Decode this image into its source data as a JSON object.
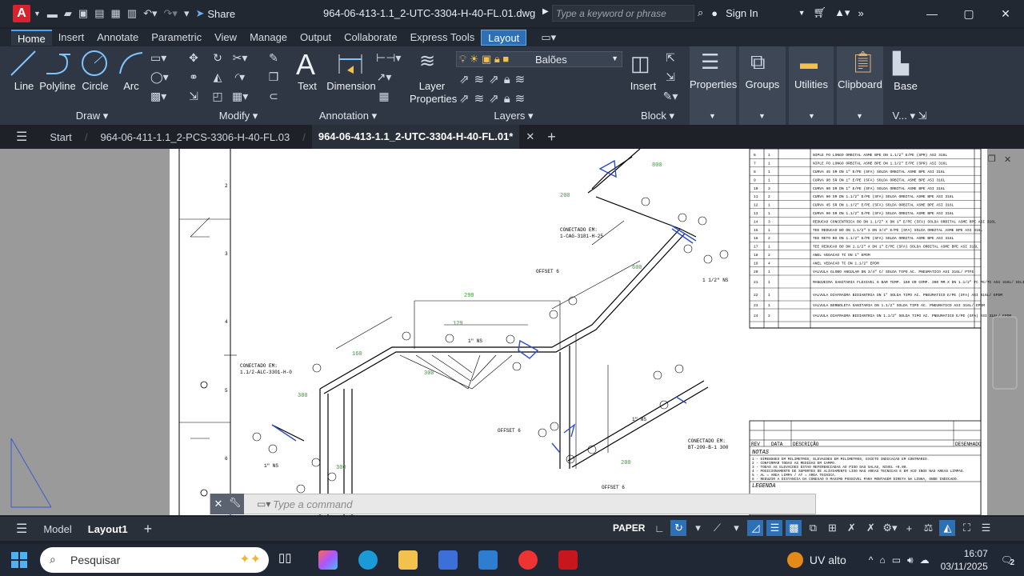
{
  "app": {
    "logo_letter": "A",
    "share_label": "Share",
    "title": "964-06-413-1.1_2-UTC-3304-H-40-FL.01.dwg",
    "search_placeholder": "Type a keyword or phrase",
    "sign_in": "Sign In"
  },
  "ribbon_tabs": [
    "Home",
    "Insert",
    "Annotate",
    "Parametric",
    "View",
    "Manage",
    "Output",
    "Collaborate",
    "Express Tools",
    "Layout"
  ],
  "draw": {
    "line": "Line",
    "polyline": "Polyline",
    "circle": "Circle",
    "arc": "Arc",
    "group": "Draw"
  },
  "modify": {
    "group": "Modify"
  },
  "annotation": {
    "text": "Text",
    "dimension": "Dimension",
    "group": "Annotation"
  },
  "layers": {
    "layer_properties": "Layer Properties",
    "current_layer": "Balões",
    "group": "Layers"
  },
  "block": {
    "insert": "Insert",
    "group": "Block"
  },
  "panels": {
    "properties": "Properties",
    "groups": "Groups",
    "utilities": "Utilities",
    "clipboard": "Clipboard",
    "base": "Base",
    "view_short": "V..."
  },
  "doc_tabs": {
    "start": "Start",
    "tab1": "964-06-411-1.1_2-PCS-3306-H-40-FL.03",
    "tab2": "964-06-413-1.1_2-UTC-3304-H-40-FL.01*"
  },
  "command": {
    "placeholder": "Type a command"
  },
  "status": {
    "model": "Model",
    "layout1": "Layout1",
    "paper": "PAPER"
  },
  "taskbar": {
    "search": "Pesquisar",
    "weather": "UV alto",
    "time": "16:07",
    "date": "03/11/2025",
    "badge": "2"
  },
  "drawing": {
    "row_numbers": [
      "2",
      "3",
      "4",
      "5",
      "6"
    ],
    "labels": {
      "connected1": "CONECTADO EM:",
      "connected1b": "1-CAG-3181-H-25",
      "connected2": "CONECTADO EM:",
      "connected2b": "1.1/2-ALC-3301-H-0",
      "connected3": "CONECTADO EM:",
      "connected3b": "BT-209-B-1 300",
      "offset1": "OFFSET 6",
      "offset2": "OFFSET 6",
      "offset3": "OFFSET 6",
      "ns1": "1\" NS",
      "ns2": "1 1/2\" NS",
      "ns3": "1\" NS",
      "ns4": "1\" NS",
      "dim1": "298",
      "dim2": "129"
    },
    "bom_rows": [
      [
        "6",
        "1",
        "NIPLE FO LONGO ORBITAL ASME BPE DN 1.1/2\" E/PE (SPR) ASI 316L"
      ],
      [
        "7",
        "1",
        "NIPLE FO LONGO ORBITAL ASME BPE DN 1.1/2\" E/PE (SPR) ASI 316L"
      ],
      [
        "8",
        "1",
        "CURVA 45 SR DN 1\" E/PE (SFA) SOLDA ORBITAL ASME BPE ASI 316L"
      ],
      [
        "9",
        "1",
        "CURVA 90 SR DN 1\" E/PE (SFA) SOLDA ORBITAL ASME BPE ASI 316L"
      ],
      [
        "10",
        "3",
        "CURVA 90 SR DN 1\" E/PE (SFA) SOLDA ORBITAL ASME BPE ASI 316L"
      ],
      [
        "11",
        "2",
        "CURVA 90 SR DN 1.1/2\" E/PE (SFA) SOLDA ORBITAL ASME BPE ASI 316L"
      ],
      [
        "12",
        "1",
        "CURVA 45 SR DN 1.1/2\" E/PE (SFA) SOLDA ORBITAL ASME BPE ASI 316L"
      ],
      [
        "13",
        "1",
        "CURVA 90 SR DN 1.1/2\" E/PE (SFA) SOLDA ORBITAL ASME BPE ASI 316L"
      ],
      [
        "14",
        "3",
        "REDUCAO CONCENTRICA BO DN 1.1/2\" X DN 1\" E/PE (SFA) SOLDA ORBITAL ASME BPE ASI 316L"
      ],
      [
        "15",
        "1",
        "TEE REDUCAO BO DN 1.1/2\" X DN 3/4\" E/PE (SFA) SOLDA ORBITAL ASME BPE ASI 316L"
      ],
      [
        "16",
        "2",
        "TEE RETO BO DN 1.1/2\" E/PE (SFA) SOLDA ORBITAL ASME BPE ASI 316L"
      ],
      [
        "17",
        "1",
        "TEE REDUCAO BO DN 1.1/2\" X DN 1\" E/PE (SFA) SOLDA ORBITAL ASME BPE ASI 316L"
      ],
      [
        "18",
        "2",
        "ANEL VEDACAO TC DN 1\" EPDM"
      ],
      [
        "19",
        "4",
        "ANEL VEDACAO TC DN 1.1/2\" EPDM"
      ],
      [
        "20",
        "1",
        "VALVULA GLOBO ANGULAR DN 3/4\" C/ SOLDA TIPO AC. PNEUMATICO ASI 316L/ PTFE"
      ],
      [
        "21",
        "1",
        "MANGUEIRA SANITARIA FLEXIVEL 6 BAR TEMP. 150 GR COMP. 300 MM X DN 1.1/2\" TC PE/TC ASI 316L/ SILICONE"
      ],
      [
        "22",
        "1",
        "VALVULA DIAFRAGMA BIDIANTRIA DN 1\" SOLDA TIPO AC. PNEUMATICO E/PE (SFA) ASI 316L/ EPDM"
      ],
      [
        "23",
        "1",
        "VALVULA BORBOLETA SANITARIA DN 1.1/2\" SOLDA TIPO AC. PNEUMATICO ASI 316L/ EPDM"
      ],
      [
        "24",
        "2",
        "VALVULA DIAFRAGMA BIDIANTRIA DN 1.1/2\" SOLDA TIPO AC. PNEUMATICO E/PE (SFA) ASI 316L/ EPDM"
      ]
    ],
    "rev_headers": {
      "rev": "REV",
      "data": "DATA",
      "desc": "DESCRIÇÃO",
      "des": "DESENHADO"
    },
    "notas_title": "NOTAS",
    "notas": [
      "1 - DIMENSOES EM MILIMETROS, ELEVACOES EM MILIMETROS, EXCETO INDICACAO EM CONTRARIO.",
      "2 - CONFIRMAR TODAS AS MEDIDAS EM CAMPO.",
      "3 - TODAS AS ELEVACOES ESTAO REFERENCIADAS AO PISO DAS SALAS, NIVEL +0.00.",
      "4 - POSICIONAMENTO DE SUPORTES DE ALIVIAMENTO LISO NAS AREAS TECNICAS E EM ACO INOX NAS AREAS LIMPAS.",
      "5 - AL = AREA LIMPA / AT = AREA TECNICA.",
      "6 - REDUZIR A DISTANCIA DA CONEXAO O MAXIMO POSSIVEL PARA MONTAGEM DIRETA NA LINHA, ONDE INDICADO."
    ],
    "legenda_title": "LEGENDA"
  }
}
